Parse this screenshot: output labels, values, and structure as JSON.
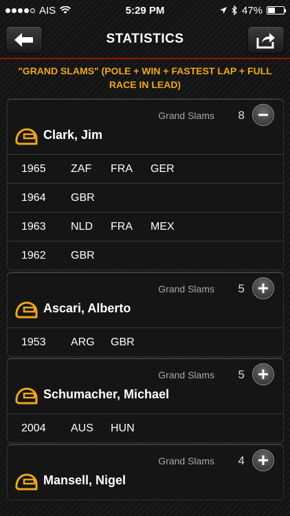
{
  "status_bar": {
    "carrier": "AIS",
    "time": "5:29 PM",
    "battery": "47%",
    "battery_level": 0.47
  },
  "nav": {
    "title": "STATISTICS",
    "back_icon": "arrow-left-icon",
    "share_icon": "share-icon"
  },
  "subtitle": "\"GRAND SLAMS\" (POLE + WIN + FASTEST LAP + FULL RACE IN LEAD)",
  "accent": "#f0a818",
  "drivers": [
    {
      "name": "Clark, Jim",
      "label": "Grand Slams",
      "count": "8",
      "expanded": true,
      "rows": [
        {
          "year": "1965",
          "countries": [
            "ZAF",
            "FRA",
            "GER"
          ]
        },
        {
          "year": "1964",
          "countries": [
            "GBR"
          ]
        },
        {
          "year": "1963",
          "countries": [
            "NLD",
            "FRA",
            "MEX"
          ]
        },
        {
          "year": "1962",
          "countries": [
            "GBR"
          ]
        }
      ]
    },
    {
      "name": "Ascari, Alberto",
      "label": "Grand Slams",
      "count": "5",
      "expanded": false,
      "rows": [
        {
          "year": "1953",
          "countries": [
            "ARG",
            "GBR"
          ]
        }
      ]
    },
    {
      "name": "Schumacher, Michael",
      "label": "Grand Slams",
      "count": "5",
      "expanded": false,
      "rows": [
        {
          "year": "2004",
          "countries": [
            "AUS",
            "HUN"
          ]
        }
      ]
    },
    {
      "name": "Mansell, Nigel",
      "label": "Grand Slams",
      "count": "4",
      "expanded": false,
      "rows": []
    }
  ]
}
